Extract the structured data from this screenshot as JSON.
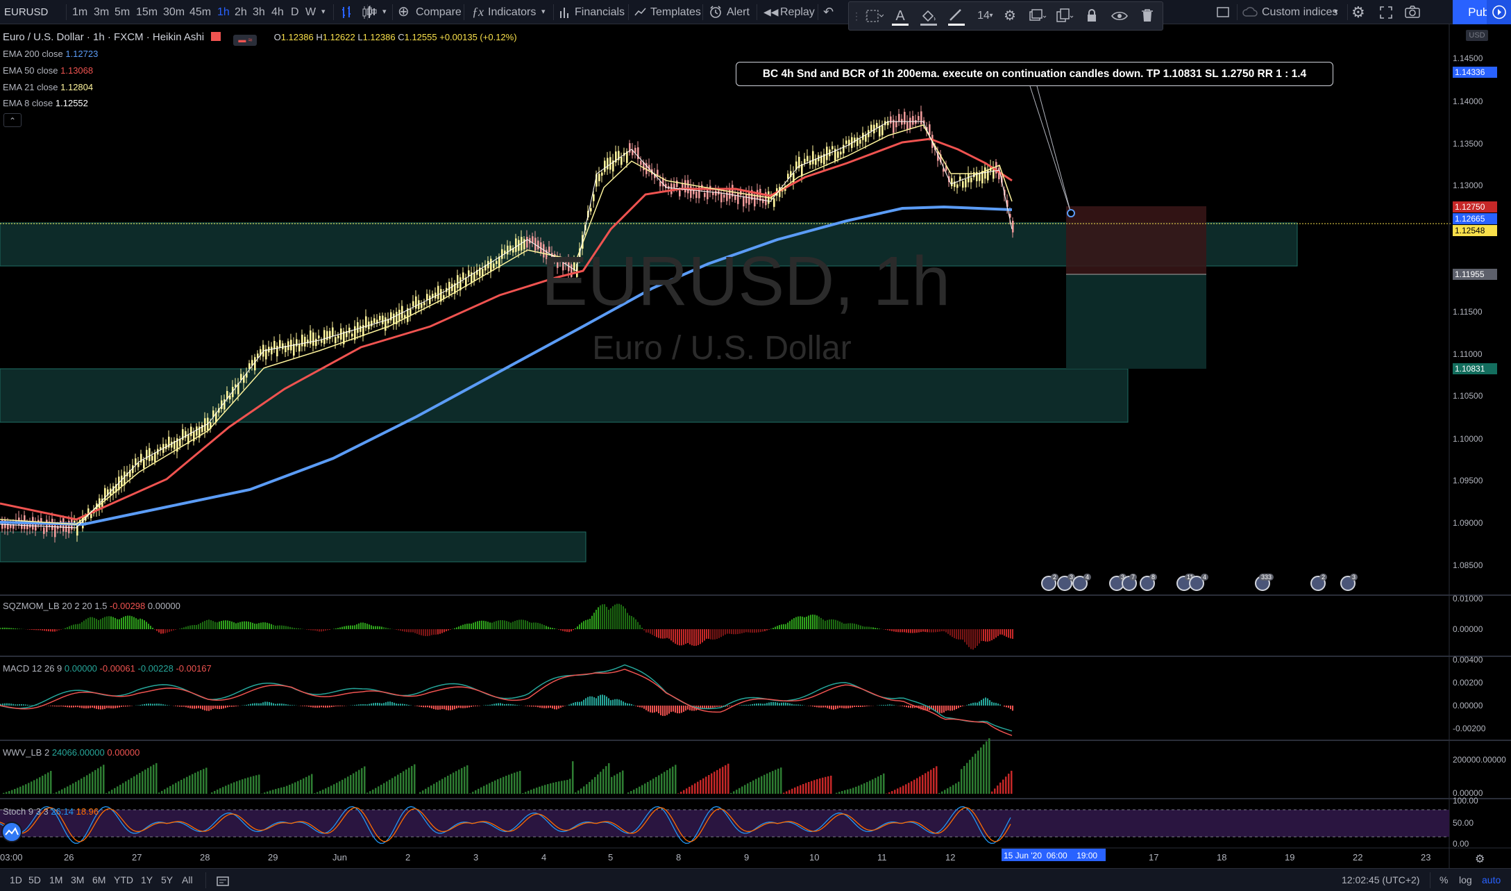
{
  "toolbar": {
    "symbol": "EURUSD",
    "intervals": [
      "1m",
      "3m",
      "5m",
      "15m",
      "30m",
      "45m",
      "1h",
      "2h",
      "3h",
      "4h",
      "D",
      "W"
    ],
    "active_interval": "1h",
    "compare_label": "Compare",
    "indicators_label": "Indicators",
    "financials_label": "Financials",
    "templates_label": "Templates",
    "alert_label": "Alert",
    "replay_label": "Replay",
    "custom_indices_label": "Custom indices",
    "publish_label": "Publish"
  },
  "drawing_toolbar": {
    "font_size": "14"
  },
  "header": {
    "pair_title": "Euro / U.S. Dollar · 1h · FXCM · Heikin Ashi",
    "ohlc": {
      "o_label": "O",
      "o": "1.12386",
      "h_label": "H",
      "h": "1.12622",
      "l_label": "L",
      "l": "1.12386",
      "c_label": "C",
      "c": "1.12555",
      "change": "+0.00135 (+0.12%)"
    }
  },
  "ema_legend": [
    {
      "label": "EMA 200 close",
      "value": "1.12723",
      "color": "#5b9cf6"
    },
    {
      "label": "EMA 50 close",
      "value": "1.13068",
      "color": "#ef5350"
    },
    {
      "label": "EMA 21 close",
      "value": "1.12804",
      "color": "#fff59d"
    },
    {
      "label": "EMA 8 close",
      "value": "1.12552",
      "color": "#ffffff"
    }
  ],
  "watermark": {
    "symbol": "EURUSD, 1h",
    "description": "Euro / U.S. Dollar"
  },
  "annotation": {
    "text": "BC 4h Snd and BCR of 1h 200ema. execute on continuation candles down. TP 1.10831 SL 1.2750 RR 1 : 1.4"
  },
  "price_axis": {
    "currency": "USD",
    "labels": [
      "1.14500",
      "1.14000",
      "1.13500",
      "1.13000",
      "1.11500",
      "1.11000",
      "1.10500",
      "1.10000",
      "1.09500",
      "1.09000",
      "1.08500"
    ],
    "badges": [
      {
        "value": "1.14336",
        "color": "#2962ff"
      },
      {
        "value": "1.12750",
        "color": "#c62828"
      },
      {
        "value": "1.12665",
        "color": "#2962ff"
      },
      {
        "value": "1.12548",
        "color": "#f9e04b"
      },
      {
        "value": "1.11955",
        "color": "#5d606b"
      },
      {
        "value": "1.10831",
        "color": "#136e5e"
      }
    ]
  },
  "indicators": {
    "sqzmom": {
      "name": "SQZMOM_LB",
      "params": "20 2 20 1.5",
      "v1": "-0.00298",
      "v2": "0.00000",
      "axis": [
        "0.01000",
        "0.00000"
      ]
    },
    "macd": {
      "name": "MACD",
      "params": "12 26 9",
      "v1": "0.00000",
      "v2": "-0.00061",
      "v3": "-0.00228",
      "v4": "-0.00167",
      "axis": [
        "0.00400",
        "0.00200",
        "0.00000",
        "-0.00200"
      ]
    },
    "wwv": {
      "name": "WWV_LB",
      "params": "2",
      "v1": "24066.00000",
      "v2": "0.00000",
      "axis": [
        "200000.00000",
        "0.00000"
      ]
    },
    "stoch": {
      "name": "Stoch",
      "params": "9 3 3",
      "v1": "26.14",
      "v2": "18.96",
      "axis": [
        "100.00",
        "50.00",
        "0.00"
      ]
    }
  },
  "time_axis": {
    "labels": [
      "03:00",
      "26",
      "27",
      "28",
      "29",
      "Jun",
      "2",
      "3",
      "4",
      "5",
      "8",
      "9",
      "10",
      "11",
      "12",
      "17",
      "18",
      "19",
      "22",
      "23"
    ],
    "cursor_label": "15 Jun '20",
    "cursor_times": [
      "06:00",
      "19:00"
    ]
  },
  "events": {
    "counts": [
      "2",
      "3",
      "4",
      "3",
      "7",
      "8",
      "11",
      "4",
      "333",
      "2",
      "3"
    ]
  },
  "bottom_bar": {
    "ranges": [
      "1D",
      "5D",
      "1M",
      "3M",
      "6M",
      "YTD",
      "1Y",
      "5Y",
      "All"
    ],
    "clock": "12:02:45 (UTC+2)",
    "percent_label": "%",
    "log_label": "log",
    "auto_label": "auto"
  }
}
